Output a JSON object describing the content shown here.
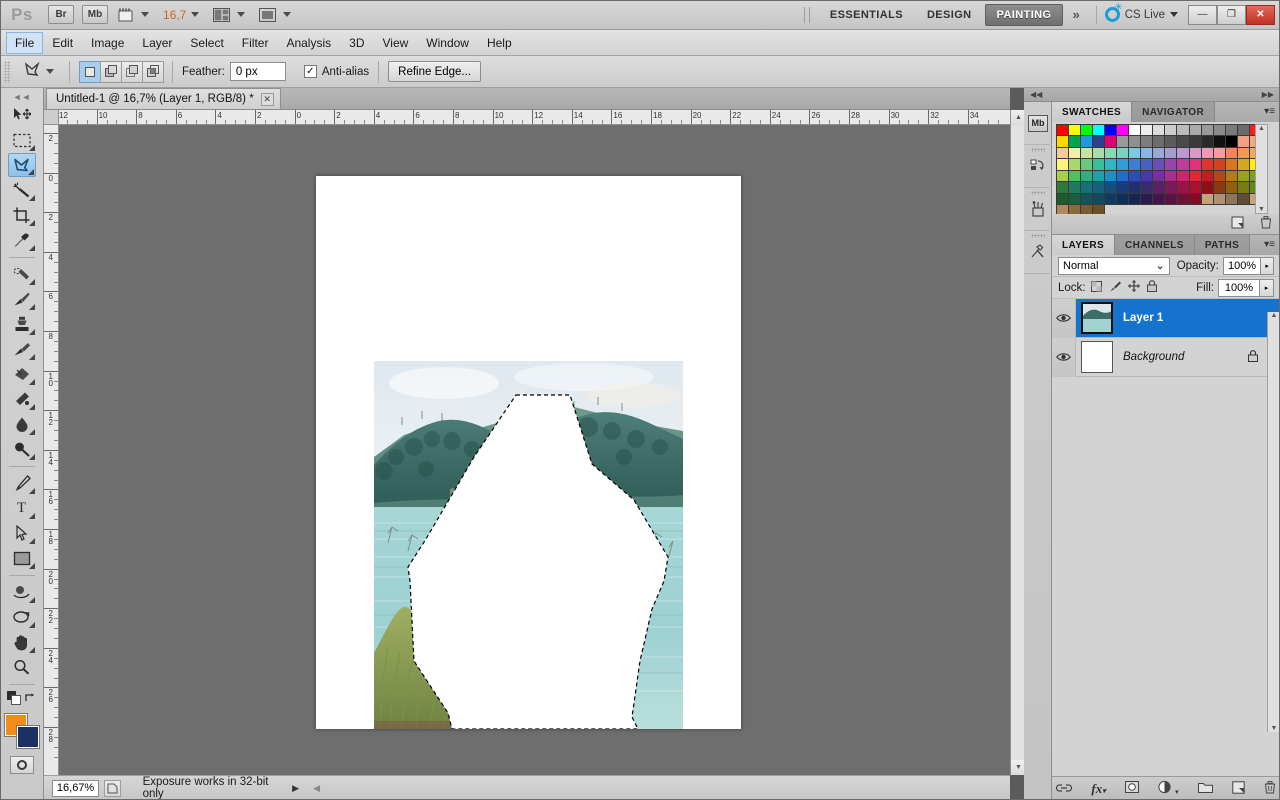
{
  "app": {
    "name": "Ps",
    "title": "Photoshop CS5"
  },
  "titlebar": {
    "bridge_label": "Br",
    "minibridge_label": "Mb",
    "view_extras_icon": "view-extras-icon",
    "zoom_level": "16,7",
    "arrange_icon": "arrange-documents-icon",
    "screenmode_icon": "screen-mode-icon",
    "workspaces": [
      {
        "label": "ESSENTIALS",
        "active": false
      },
      {
        "label": "DESIGN",
        "active": false
      },
      {
        "label": "PAINTING",
        "active": true
      }
    ],
    "more_workspaces": "»",
    "cslive_label": "CS Live",
    "window_buttons": {
      "minimize": "—",
      "restore": "❐",
      "close": "✕"
    }
  },
  "menubar": {
    "items": [
      {
        "label": "File",
        "active": true
      },
      {
        "label": "Edit",
        "active": false
      },
      {
        "label": "Image",
        "active": false
      },
      {
        "label": "Layer",
        "active": false
      },
      {
        "label": "Select",
        "active": false
      },
      {
        "label": "Filter",
        "active": false
      },
      {
        "label": "Analysis",
        "active": false
      },
      {
        "label": "3D",
        "active": false
      },
      {
        "label": "View",
        "active": false
      },
      {
        "label": "Window",
        "active": false
      },
      {
        "label": "Help",
        "active": false
      }
    ]
  },
  "optionsbar": {
    "tool_icon": "lasso-tool-icon",
    "selection_modes": [
      {
        "name": "new-selection",
        "active": true
      },
      {
        "name": "add-to-selection",
        "active": false
      },
      {
        "name": "subtract-from-selection",
        "active": false
      },
      {
        "name": "intersect-with-selection",
        "active": false
      }
    ],
    "feather_label": "Feather:",
    "feather_value": "0 px",
    "antialias_label": "Anti-alias",
    "antialias_checked": true,
    "refine_edge_label": "Refine Edge..."
  },
  "toolbox": {
    "tools": [
      {
        "name": "move-tool",
        "glyph": "⬉",
        "selected": false,
        "has_flyout": false
      },
      {
        "name": "rectangular-marquee-tool",
        "glyph": "⬚",
        "selected": false,
        "has_flyout": true
      },
      {
        "name": "lasso-tool",
        "glyph": "✠",
        "selected": true,
        "has_flyout": true
      },
      {
        "name": "magic-wand-tool",
        "glyph": "✦",
        "selected": false,
        "has_flyout": true
      },
      {
        "name": "crop-tool",
        "glyph": "⌗",
        "selected": false,
        "has_flyout": true
      },
      {
        "name": "eyedropper-tool",
        "glyph": "✎",
        "selected": false,
        "has_flyout": true
      },
      {
        "name": "spot-healing-brush-tool",
        "glyph": "✒",
        "selected": false,
        "has_flyout": true
      },
      {
        "name": "brush-tool",
        "glyph": "✏",
        "selected": false,
        "has_flyout": true
      },
      {
        "name": "clone-stamp-tool",
        "glyph": "⬛",
        "selected": false,
        "has_flyout": true
      },
      {
        "name": "history-brush-tool",
        "glyph": "✐",
        "selected": false,
        "has_flyout": true
      },
      {
        "name": "eraser-tool",
        "glyph": "✄",
        "selected": false,
        "has_flyout": true
      },
      {
        "name": "gradient-tool",
        "glyph": "◧",
        "selected": false,
        "has_flyout": true
      },
      {
        "name": "blur-tool",
        "glyph": "●",
        "selected": false,
        "has_flyout": true
      },
      {
        "name": "dodge-tool",
        "glyph": "⚲",
        "selected": false,
        "has_flyout": true
      },
      {
        "name": "pen-tool",
        "glyph": "✒",
        "selected": false,
        "has_flyout": true
      },
      {
        "name": "horizontal-type-tool",
        "glyph": "T",
        "selected": false,
        "has_flyout": true
      },
      {
        "name": "path-selection-tool",
        "glyph": "➤",
        "selected": false,
        "has_flyout": true
      },
      {
        "name": "rectangle-shape-tool",
        "glyph": "■",
        "selected": false,
        "has_flyout": true
      },
      {
        "name": "3d-object-rotate-tool",
        "glyph": "◔",
        "selected": false,
        "has_flyout": true
      },
      {
        "name": "3d-camera-orbit-tool",
        "glyph": "↺",
        "selected": false,
        "has_flyout": true
      },
      {
        "name": "hand-tool",
        "glyph": "✋",
        "selected": false,
        "has_flyout": true
      },
      {
        "name": "zoom-tool",
        "glyph": "⚲",
        "selected": false,
        "has_flyout": false
      }
    ],
    "foreground_color": "#f28c18",
    "background_color": "#1c3161",
    "quickmask_icon": "quick-mask-icon"
  },
  "document": {
    "tab_title": "Untitled-1 @ 16,7% (Layer 1, RGB/8) *",
    "close_icon": "✕",
    "ruler_h_labels": [
      "12",
      "10",
      "8",
      "6",
      "4",
      "2",
      "0",
      "2",
      "4",
      "6",
      "8",
      "10",
      "12",
      "14",
      "16",
      "18",
      "20",
      "22",
      "24",
      "26",
      "28",
      "30",
      "32",
      "34"
    ],
    "ruler_v_labels": [
      "2",
      "0",
      "2",
      "4",
      "6",
      "8",
      "10",
      "12",
      "14",
      "16",
      "18",
      "20",
      "22",
      "24",
      "26",
      "28"
    ],
    "ruler_units": "cm"
  },
  "canvas": {
    "artboard_color": "#ffffff",
    "photo_description": "landscape-photo-lake-and-forested-hills",
    "selection_description": "polygonal-lasso-selection-filled-white",
    "sky_colors": [
      "#e9eef2",
      "#dfe8ee"
    ],
    "hill_colors": [
      "#3e6f72",
      "#2f5f5e",
      "#4a7d6e"
    ],
    "water_colors": [
      "#9fd3d2",
      "#8ec9cb",
      "#b7dedd"
    ],
    "grass_color": "#7a8f4a"
  },
  "statusbar": {
    "zoom_value": "16,67%",
    "doc_info_icon": "document-info-icon",
    "message": "Exposure works in 32-bit only",
    "expand_arrow": "▶",
    "collapse_arrow": "◀"
  },
  "dock": {
    "collapse_left_icon": "◀◀",
    "collapse_right_icon": "▶▶",
    "icon_buttons": [
      {
        "name": "mini-bridge-icon",
        "label": "Mb"
      },
      {
        "name": "history-icon",
        "label": "↶"
      },
      {
        "name": "tool-presets-icon",
        "label": "⚘"
      },
      {
        "name": "adjustments-icon",
        "label": "⚒"
      }
    ]
  },
  "swatches_panel": {
    "tabs": [
      {
        "label": "SWATCHES",
        "active": true
      },
      {
        "label": "NAVIGATOR",
        "active": false
      }
    ],
    "menu_icon": "panel-menu-icon",
    "footer_buttons": [
      {
        "name": "new-swatch-button",
        "glyph": "◳"
      },
      {
        "name": "delete-swatch-button",
        "glyph": "Ὕ1"
      }
    ],
    "colors": [
      "#ff0000",
      "#ffff00",
      "#00ff00",
      "#00ffff",
      "#0000ff",
      "#ff00ff",
      "#ffffff",
      "#ededed",
      "#dcdcdc",
      "#cccccc",
      "#bbbbbb",
      "#aaaaaa",
      "#999999",
      "#8a8a8a",
      "#7a7a7a",
      "#6b6b6b",
      "#ff1a1a",
      "#ffd800",
      "#00a550",
      "#1e9ae0",
      "#2f3f8f",
      "#e00070",
      "#9a9a9a",
      "#8f8f8f",
      "#7d7d7d",
      "#6d6d6d",
      "#5c5c5c",
      "#4a4a4a",
      "#3a3a3a",
      "#2a2a2a",
      "#111111",
      "#000000",
      "#f2a088",
      "#f2a878",
      "#f7c9a0",
      "#f7efa8",
      "#c8e3a0",
      "#a8dca8",
      "#8fd7b4",
      "#7fd0c2",
      "#7ec8e3",
      "#8ab6e0",
      "#96a9d9",
      "#a79bd4",
      "#bb98cf",
      "#d69ac6",
      "#e89bb4",
      "#f29ca0",
      "#f2845f",
      "#f29a55",
      "#f2a958",
      "#fff27a",
      "#a8d96b",
      "#68c97f",
      "#3bbf9b",
      "#2fb5c4",
      "#2f9ed6",
      "#3a7fd1",
      "#4a5fc0",
      "#6a4fb5",
      "#9446ad",
      "#c03c9a",
      "#e0327a",
      "#e0352f",
      "#d4421f",
      "#d6761f",
      "#d1a81f",
      "#fff000",
      "#a8cf4a",
      "#4fbf5f",
      "#2fae80",
      "#1f9fa8",
      "#1e8ec4",
      "#1f6fc4",
      "#2a4fb0",
      "#4a3aa8",
      "#7a2f9e",
      "#a82f8c",
      "#d0246e",
      "#e02832",
      "#c11f1f",
      "#b04a1a",
      "#b57a1a",
      "#9aa01f",
      "#7a9e2a",
      "#2f7a3a",
      "#1f7a5f",
      "#1a6f7a",
      "#17607f",
      "#154f80",
      "#143f7a",
      "#202f6f",
      "#3a2a68",
      "#5a2068",
      "#7a1a5c",
      "#9a1447",
      "#a81230",
      "#8f1010",
      "#8a3a10",
      "#8f6010",
      "#7a7a12",
      "#5f8a1a",
      "#1a5c2a",
      "#15603f",
      "#12545c",
      "#0f4a60",
      "#0d3c62",
      "#0c2f5c",
      "#162353",
      "#2a1a4f",
      "#45144f",
      "#5c1044",
      "#731036",
      "#7f0e24",
      "#c9a177",
      "#b59070",
      "#8f7458",
      "#5f4c38",
      "#c9a575",
      "#b08a5a",
      "#8a6a3a",
      "#7a5c32",
      "#6b4f2a"
    ]
  },
  "layers_panel": {
    "tabs": [
      {
        "label": "LAYERS",
        "active": true
      },
      {
        "label": "CHANNELS",
        "active": false
      },
      {
        "label": "PATHS",
        "active": false
      }
    ],
    "menu_icon": "panel-menu-icon",
    "blend_mode": "Normal",
    "opacity_label": "Opacity:",
    "opacity_value": "100%",
    "lock_label": "Lock:",
    "lock_icons": [
      {
        "name": "lock-transparent-pixels-icon",
        "glyph": "▨"
      },
      {
        "name": "lock-image-pixels-icon",
        "glyph": "✏"
      },
      {
        "name": "lock-position-icon",
        "glyph": "✣"
      },
      {
        "name": "lock-all-icon",
        "glyph": "🔒"
      }
    ],
    "fill_label": "Fill:",
    "fill_value": "100%",
    "layers": [
      {
        "name": "Layer 1",
        "selected": true,
        "visible": true,
        "locked": false,
        "thumb": "image-with-cutout"
      },
      {
        "name": "Background",
        "selected": false,
        "visible": true,
        "locked": true,
        "thumb": "white"
      }
    ],
    "footer_buttons": [
      {
        "name": "link-layers-button",
        "glyph": "⚭"
      },
      {
        "name": "layer-style-button",
        "glyph": "fx"
      },
      {
        "name": "add-layer-mask-button",
        "glyph": "▣"
      },
      {
        "name": "new-fill-adjustment-button",
        "glyph": "◑"
      },
      {
        "name": "new-group-button",
        "glyph": "▱"
      },
      {
        "name": "new-layer-button",
        "glyph": "◳"
      },
      {
        "name": "delete-layer-button",
        "glyph": "🗑"
      }
    ]
  }
}
